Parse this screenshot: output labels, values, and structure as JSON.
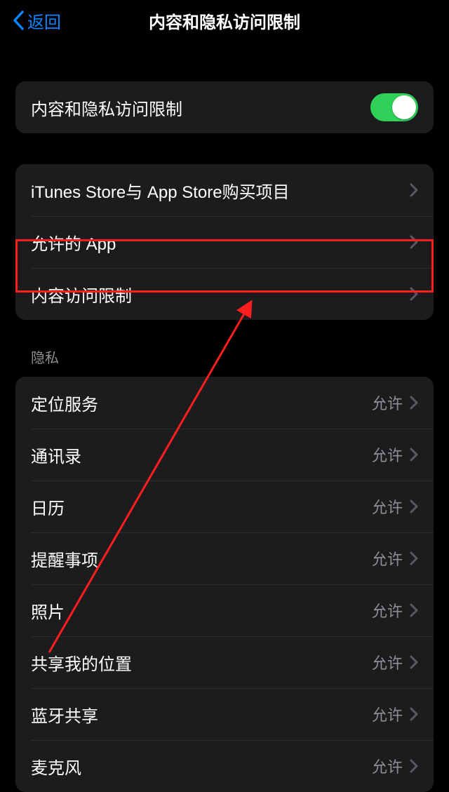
{
  "header": {
    "back_label": "返回",
    "title": "内容和隐私访问限制"
  },
  "toggle_row": {
    "label": "内容和隐私访问限制",
    "on": true
  },
  "main_group": [
    {
      "label": "iTunes Store与 App Store购买项目"
    },
    {
      "label": "允许的 App"
    },
    {
      "label": "内容访问限制"
    }
  ],
  "privacy_section_label": "隐私",
  "privacy_group": [
    {
      "label": "定位服务",
      "value": "允许"
    },
    {
      "label": "通讯录",
      "value": "允许"
    },
    {
      "label": "日历",
      "value": "允许"
    },
    {
      "label": "提醒事项",
      "value": "允许"
    },
    {
      "label": "照片",
      "value": "允许"
    },
    {
      "label": "共享我的位置",
      "value": "允许"
    },
    {
      "label": "蓝牙共享",
      "value": "允许"
    },
    {
      "label": "麦克风",
      "value": "允许"
    }
  ],
  "annotation": {
    "highlight_index": 2,
    "arrow_color": "#ff1e1e"
  }
}
